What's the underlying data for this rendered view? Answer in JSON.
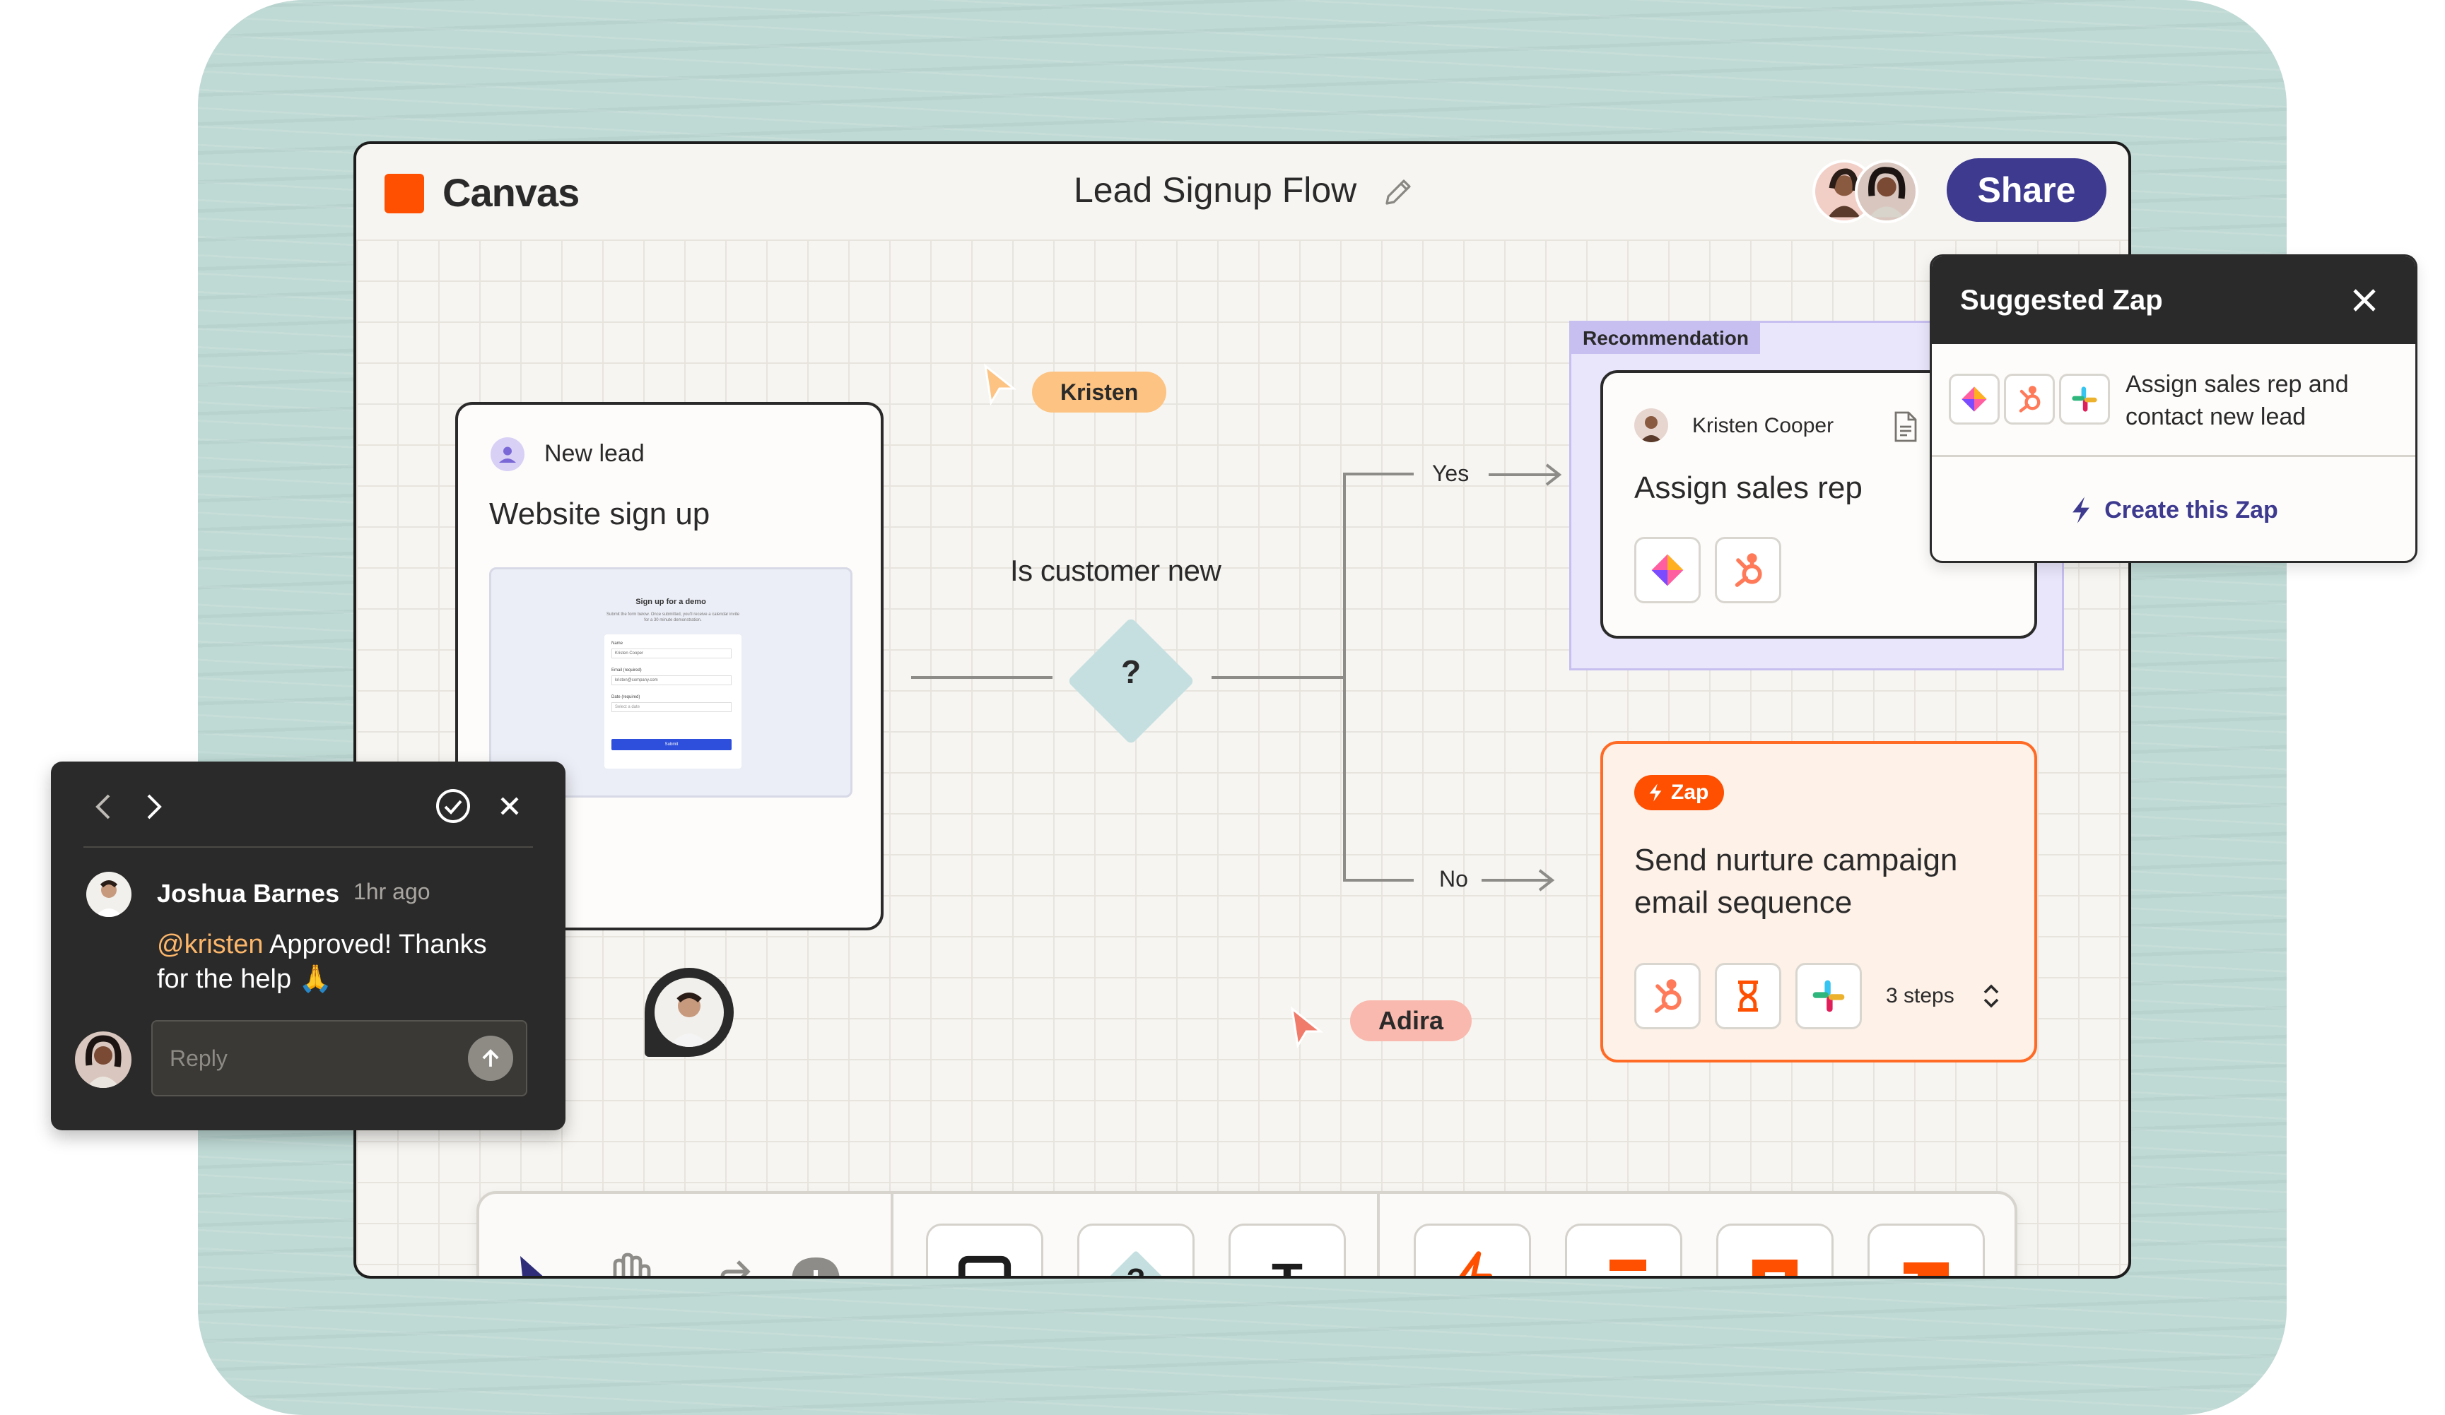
{
  "app": {
    "logo_text": "Canvas",
    "document_title": "Lead Signup Flow",
    "share_label": "Share",
    "accent_color": "#ff4f00",
    "primary_color": "#3d3a8f"
  },
  "nodes": {
    "trigger": {
      "header": "New lead",
      "title": "Website sign up",
      "form_preview": {
        "heading": "Sign up for a demo",
        "description": "Submit the form below. Once submitted, you'll receive a calendar invite for a 30 minute demonstration.",
        "field_name_label": "Name",
        "field_name_value": "Kristen Cooper",
        "field_email_label": "Email (required)",
        "field_email_value": "kristen@company.com",
        "field_date_label": "Date (required)",
        "field_date_value": "Select a date",
        "submit_label": "Submit"
      }
    },
    "decision": {
      "label": "Is customer new",
      "symbol": "?"
    },
    "branch_yes": "Yes",
    "branch_no": "No",
    "recommendation": {
      "badge": "Recommendation",
      "owner": "Kristen Cooper",
      "title": "Assign sales rep"
    },
    "zap_node": {
      "badge": "Zap",
      "title_line1": "Send nurture campaign",
      "title_line2": "email sequence",
      "steps": "3 steps"
    }
  },
  "cursors": {
    "kristen": "Kristen",
    "adira": "Adira"
  },
  "suggested_zap": {
    "title": "Suggested Zap",
    "description_line1": "Assign sales rep and",
    "description_line2": "contact new lead",
    "action": "Create this Zap"
  },
  "comment": {
    "author": "Joshua Barnes",
    "time": "1hr ago",
    "mention": "@kristen",
    "text_line1": " Approved! Thanks",
    "text_line2": "for the help 🙏",
    "reply_placeholder": "Reply"
  },
  "toolbar": {
    "tools": [
      "select-arrow-icon",
      "hand-icon",
      "connector-icon",
      "add-comment-icon"
    ],
    "shapes": [
      "square-icon",
      "decision-diamond-icon",
      "text-icon"
    ],
    "products": [
      "zap-bolt-icon",
      "tables-icon",
      "interfaces-icon",
      "chatbot-icon"
    ],
    "text_tool_glyph": "T",
    "decision_glyph": "?"
  }
}
